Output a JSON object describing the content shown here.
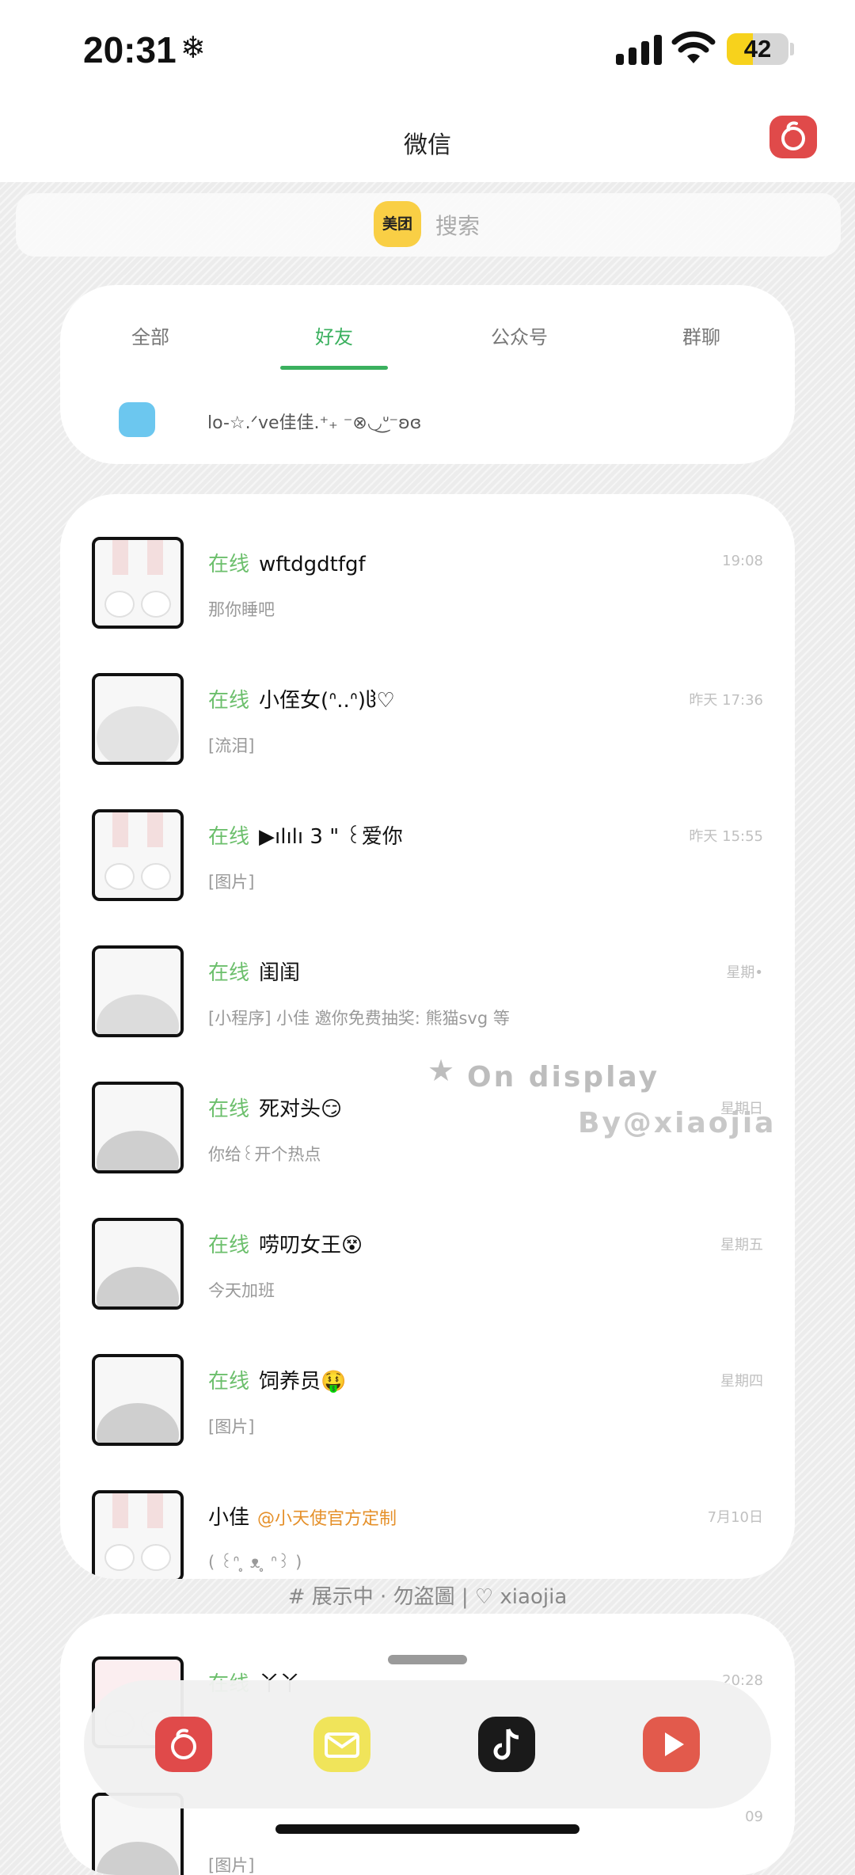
{
  "status_bar": {
    "time": "20:31",
    "battery_level": "42",
    "battery_fraction": 0.42
  },
  "header": {
    "title": "微信",
    "corner_icon": "netease-music-icon"
  },
  "search": {
    "badge": "美团",
    "placeholder": "搜索"
  },
  "tabs": [
    {
      "label": "全部",
      "active": false
    },
    {
      "label": "好友",
      "active": true
    },
    {
      "label": "公众号",
      "active": false
    },
    {
      "label": "群聊",
      "active": false
    }
  ],
  "status_row": {
    "text": "lo-☆.ᐟve佳佳.⁺₊ ⁻⊗◡͜ᐡ⁻ʚɞ"
  },
  "chats": [
    {
      "online": "在线",
      "name": "wftdgdtfgf",
      "time": "19:08",
      "preview": "那你睡吧"
    },
    {
      "online": "在线",
      "name": "小侄女(ᐢ..ᐢ)ჱ♡",
      "time": "昨天 17:36",
      "preview": "[流泪]"
    },
    {
      "online": "在线",
      "name": "▶ılılı 3 \" ꒰爱你",
      "time": "昨天 15:55",
      "preview": "[图片]"
    },
    {
      "online": "在线",
      "name": "闺闺",
      "time": "星期•",
      "preview": "[小程序] 小佳 邀你免费抽奖: 熊猫svg 等"
    },
    {
      "online": "在线",
      "name": "死对头😏",
      "time": "星期日",
      "preview": "你给꒰开个热点"
    },
    {
      "online": "在线",
      "name": "唠叨女王😵",
      "time": "星期五",
      "preview": "今天加班"
    },
    {
      "online": "在线",
      "name": "饲养员🤑",
      "time": "星期四",
      "preview": "[图片]"
    },
    {
      "online": "",
      "name": "小佳",
      "tag": "@小天使官方定制",
      "time": "7月10日",
      "preview": "( ꒰ᐢ ̥ ᴥ ̥ ᐢ꒱ )"
    }
  ],
  "watermark": {
    "line1": "On display",
    "line2": "By@xiaojia"
  },
  "footer_note": "# 展示中 · 勿盗圖 | ♡ xiaojia",
  "bottom_chat": {
    "online": "在线",
    "name": "丫丫",
    "time": "20:28",
    "time2": "09",
    "preview": "[图片]"
  },
  "dock": [
    {
      "icon": "netease-music-icon",
      "color": "#e04a4a"
    },
    {
      "icon": "mail-icon",
      "color": "#f0e45a"
    },
    {
      "icon": "tiktok-icon",
      "color": "#1a1a1a"
    },
    {
      "icon": "video-play-icon",
      "color": "#e25a4c"
    }
  ]
}
